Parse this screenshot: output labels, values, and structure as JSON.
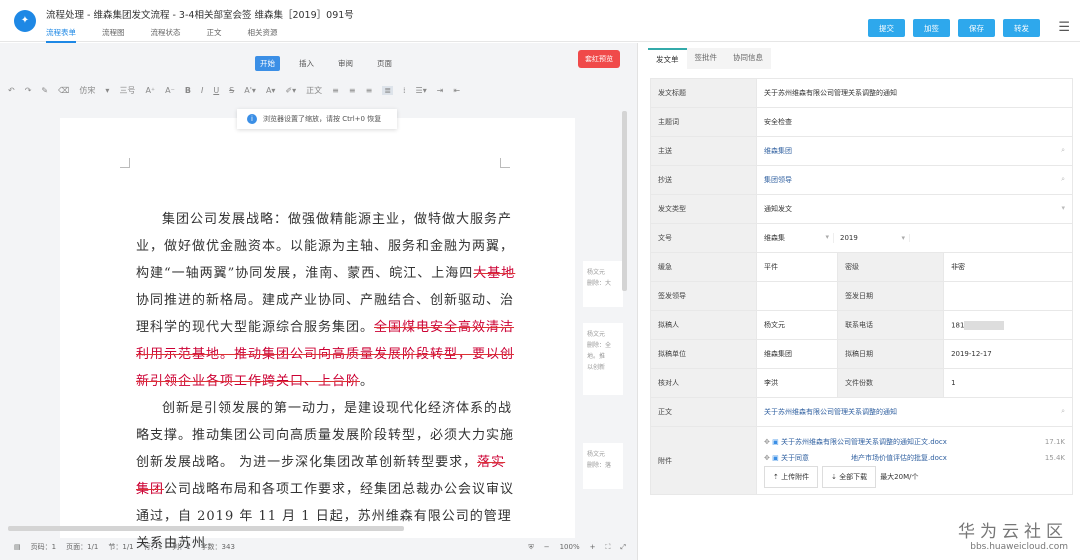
{
  "header": {
    "title": "流程处理 - 维森集团发文流程 - 3-4相关部室会签 维森集［2019］091号",
    "tabs": [
      "流程表单",
      "流程图",
      "流程状态",
      "正文",
      "相关资源"
    ],
    "buttons": [
      "提交",
      "加签",
      "保存",
      "转发"
    ]
  },
  "editor": {
    "tabs": [
      "开始",
      "插入",
      "审阅",
      "页面"
    ],
    "red_button": "套红预览",
    "toolbar": {
      "font": "仿宋",
      "size": "三号",
      "style": "正文"
    },
    "tip": "浏览器设置了缩放，请按 Ctrl+0 恢复",
    "doc": {
      "p1a": "集团公司发展战略：做强做精能源主业，做特做大服务产业，做好做优金融资本。以能源为主轴、服务和金融为两翼，构建“一轴两翼”协同发展，淮南、蒙西、皖江、上海四",
      "p1d1": "大基地",
      "p1b": "协同推进的新格局。建成产业协同、产融结合、创新驱动、治理科学的现代大型能源综合服务集团。",
      "p1d2": "全国煤电安全高效清洁利用示范基地。推动集团公司向高质量发展阶段转型，要以创新引领企业各项工作跨关口、上台阶",
      "p1c": "。",
      "p2a": "创新是引领发展的第一动力，是建设现代化经济体系的战略支撑。推动集团公司向高质量发展阶段转型，必须大力实施创新发展战略。 为进一步深化集团改革创新转型要求，",
      "p2d": "落实集团",
      "p2b": "公司战略布局和各项工作要求，经集团总裁办公会议审议通过，自 2019 年 11 月 1 日起，苏州维森有限公司的管理关系由苏州"
    },
    "comments": [
      {
        "author": "杨文元",
        "text": "删除：大"
      },
      {
        "author": "杨文元",
        "text": "删除：全",
        "extra": "地。推",
        "extra2": "以创新"
      },
      {
        "author": "杨文元",
        "text": "删除：落"
      }
    ],
    "status": {
      "page": "页码：1",
      "pages": "页面：1/1",
      "section": "节：1/1",
      "row": "行：1",
      "col": "列：1",
      "words": "字数：343",
      "zoom": "100%"
    }
  },
  "form": {
    "tabs": [
      "发文单",
      "签批件",
      "协同信息"
    ],
    "title_label": "发文标题",
    "title": "关于苏州维森有限公司管理关系调整的通知",
    "keyword_label": "主题词",
    "keyword": "安全检查",
    "to_label": "主送",
    "to": "维森集团",
    "cc_label": "抄送",
    "cc": "集团领导",
    "type_label": "发文类型",
    "type": "通知发文",
    "num_label": "文号",
    "num_prefix": "维森集",
    "num_year": "2019",
    "urgency_label": "缓急",
    "urgency": "平件",
    "secret_label": "密级",
    "secret": "非密",
    "signer_label": "签发领导",
    "sign_date_label": "签发日期",
    "drafter_label": "拟稿人",
    "drafter": "杨文元",
    "phone_label": "联系电话",
    "phone": "181",
    "unit_label": "拟稿单位",
    "unit": "维森集团",
    "date_label": "拟稿日期",
    "date": "2019-12-17",
    "checker_label": "核对人",
    "checker": "李洪",
    "copies_label": "文件份数",
    "copies": "1",
    "body_label": "正文",
    "body": "关于苏州维森有限公司管理关系调整的通知",
    "att_label": "附件",
    "attachments": [
      {
        "name": "关于苏州维森有限公司管理关系调整的通知正文.docx",
        "size": "17.1K"
      },
      {
        "name": "关于同意　　　　　　地产市场价值评估的批复.docx",
        "size": "15.4K"
      }
    ],
    "upload": "上传附件",
    "download": "全部下载",
    "limit": "最大20M/个"
  },
  "watermark": {
    "cn": "华为云社区",
    "url": "bbs.huaweicloud.com"
  }
}
